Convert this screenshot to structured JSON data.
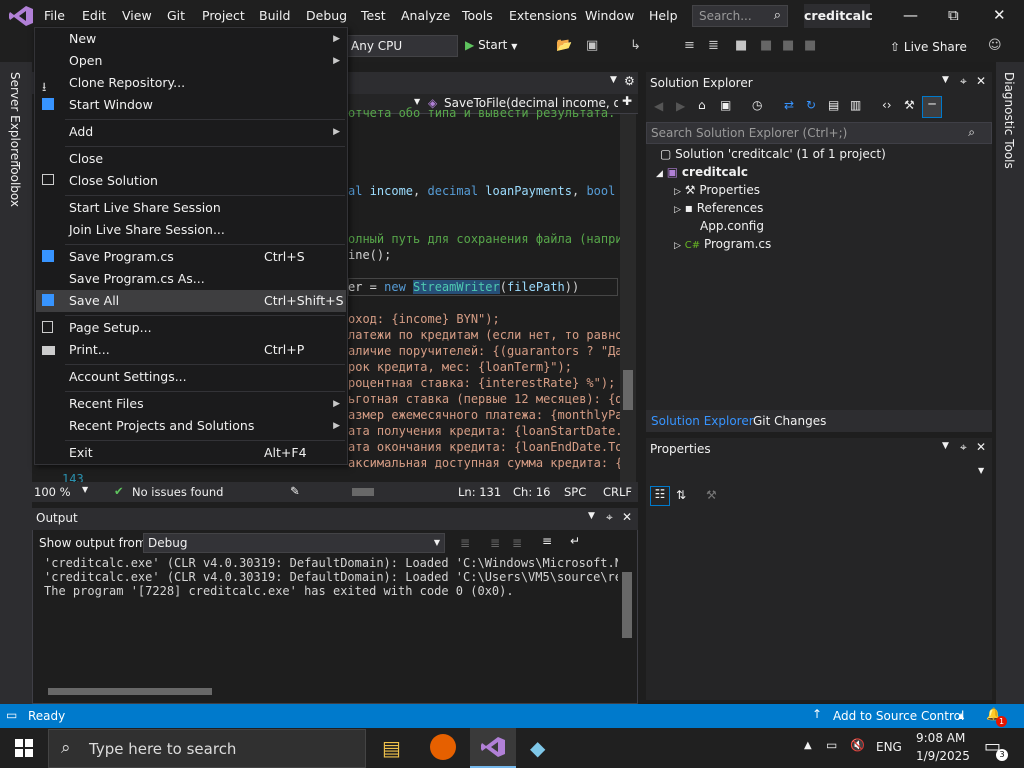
{
  "menubar": {
    "items": [
      "File",
      "Edit",
      "View",
      "Git",
      "Project",
      "Build",
      "Debug",
      "Test",
      "Analyze",
      "Tools",
      "Extensions",
      "Window",
      "Help"
    ],
    "search_placeholder": "Search...",
    "solution_name": "creditcalc"
  },
  "toolbar": {
    "platform": "Any CPU",
    "start_label": "Start",
    "live_share": "Live Share"
  },
  "left_rail": [
    "Server Explorer",
    "Toolbox"
  ],
  "right_rail": [
    "Diagnostic Tools"
  ],
  "editor": {
    "nav_method": "SaveToFile(decimal income, de",
    "code_lines": [
      "отчета обо типа и вывести результата.",
      "al income, decimal loanPayments, bool g",
      "олный путь для сохранения файла (наприм",
      "ine();",
      "er = new StreamWriter(filePath))",
      "оход: {income} BYN\");",
      "латежи по кредитам (если нет, то равно",
      "аличие поручителей: {(guarantors ? \"Да\"",
      "рок кредита, мес: {loanTerm}\");",
      "роцентная ставка: {interestRate} %\");",
      "ьготная ставка (первые 12 месяцев): {di",
      "азмер ежемесячного платежа: {monthlyPay",
      "ата получения кредита: {loanStartDate.T",
      "ата окончания кредита: {loanEndDate.ToS",
      "аксимальная доступная сумма кредита: {m"
    ],
    "line_number": "143",
    "zoom": "100 %",
    "issues": "No issues found",
    "ln": "Ln: 131",
    "ch": "Ch: 16",
    "spc": "SPC",
    "crlf": "CRLF"
  },
  "file_menu": {
    "items": [
      {
        "label": "New",
        "shortcut": "",
        "submenu": true,
        "icon": ""
      },
      {
        "label": "Open",
        "shortcut": "",
        "submenu": true,
        "icon": ""
      },
      {
        "label": "Clone Repository...",
        "shortcut": "",
        "submenu": false,
        "icon": "clone-icon"
      },
      {
        "label": "Start Window",
        "shortcut": "",
        "submenu": false,
        "icon": "start-window-icon"
      },
      {
        "label": "Add",
        "shortcut": "",
        "submenu": true,
        "icon": ""
      },
      {
        "label": "Close",
        "shortcut": "",
        "submenu": false,
        "icon": ""
      },
      {
        "label": "Close Solution",
        "shortcut": "",
        "submenu": false,
        "icon": "close-solution-icon"
      },
      {
        "label": "Start Live Share Session",
        "shortcut": "",
        "submenu": false,
        "icon": ""
      },
      {
        "label": "Join Live Share Session...",
        "shortcut": "",
        "submenu": false,
        "icon": ""
      },
      {
        "label": "Save Program.cs",
        "shortcut": "Ctrl+S",
        "submenu": false,
        "icon": "save-icon"
      },
      {
        "label": "Save Program.cs As...",
        "shortcut": "",
        "submenu": false,
        "icon": ""
      },
      {
        "label": "Save All",
        "shortcut": "Ctrl+Shift+S",
        "submenu": false,
        "icon": "save-all-icon"
      },
      {
        "label": "Page Setup...",
        "shortcut": "",
        "submenu": false,
        "icon": "page-setup-icon"
      },
      {
        "label": "Print...",
        "shortcut": "Ctrl+P",
        "submenu": false,
        "icon": "print-icon"
      },
      {
        "label": "Account Settings...",
        "shortcut": "",
        "submenu": false,
        "icon": ""
      },
      {
        "label": "Recent Files",
        "shortcut": "",
        "submenu": true,
        "icon": ""
      },
      {
        "label": "Recent Projects and Solutions",
        "shortcut": "",
        "submenu": true,
        "icon": ""
      },
      {
        "label": "Exit",
        "shortcut": "Alt+F4",
        "submenu": false,
        "icon": ""
      }
    ]
  },
  "output": {
    "title": "Output",
    "show_from_label": "Show output from:",
    "source": "Debug",
    "lines": [
      "'creditcalc.exe' (CLR v4.0.30319: DefaultDomain): Loaded 'C:\\Windows\\Microsoft.Net",
      "'creditcalc.exe' (CLR v4.0.30319: DefaultDomain): Loaded 'C:\\Users\\VM5\\source\\repo",
      "The program '[7228] creditcalc.exe' has exited with code 0 (0x0)."
    ]
  },
  "solution_explorer": {
    "title": "Solution Explorer",
    "search_placeholder": "Search Solution Explorer (Ctrl+;)",
    "solution": "Solution 'creditcalc' (1 of 1 project)",
    "project": "creditcalc",
    "children": [
      "Properties",
      "References",
      "App.config",
      "Program.cs"
    ],
    "tabs": [
      "Solution Explorer",
      "Git Changes"
    ]
  },
  "properties": {
    "title": "Properties"
  },
  "statusbar": {
    "ready": "Ready",
    "source_control": "Add to Source Control",
    "notif_count": "1"
  },
  "taskbar": {
    "search_placeholder": "Type here to search",
    "lang": "ENG",
    "time": "9:08 AM",
    "date": "1/9/2025",
    "notif_count": "3"
  },
  "colors": {
    "accent": "#007acc",
    "vs_purple": "#68217a",
    "menu_bg": "#1b1b1c",
    "highlight": "#3e3e40"
  }
}
